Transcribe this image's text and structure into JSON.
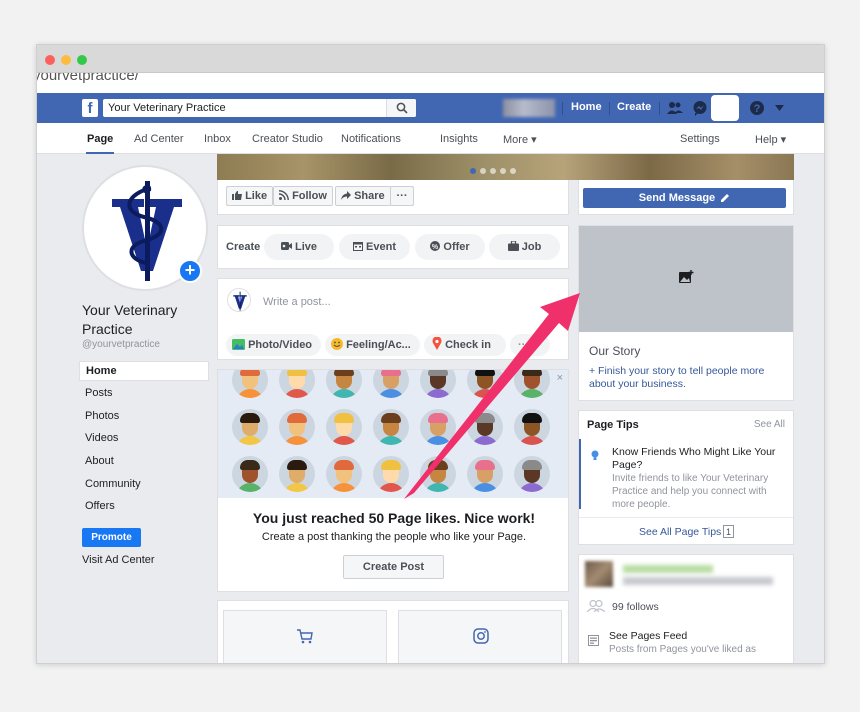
{
  "browser": {
    "url_fragment": "yourvetpractice/"
  },
  "topbar": {
    "logo": "f",
    "search_value": "Your Veterinary Practice",
    "home": "Home",
    "create": "Create"
  },
  "page_nav": {
    "items": [
      "Page",
      "Ad Center",
      "Inbox",
      "Creator Studio",
      "Notifications",
      "Insights",
      "More ▾"
    ],
    "settings": "Settings",
    "help": "Help ▾"
  },
  "profile": {
    "name": "Your Veterinary Practice",
    "handle": "@yourvetpractice",
    "add_badge": "+"
  },
  "sidebar": {
    "home": "Home",
    "items": [
      "Posts",
      "Photos",
      "Videos",
      "About",
      "Community",
      "Offers"
    ],
    "promote": "Promote",
    "visit_ad_center": "Visit Ad Center"
  },
  "actions": {
    "like": "Like",
    "follow": "Follow",
    "share": "Share",
    "more": "···",
    "send_message": "Send Message"
  },
  "create_bar": {
    "label": "Create",
    "live": "Live",
    "event": "Event",
    "offer": "Offer",
    "job": "Job"
  },
  "composer": {
    "placeholder": "Write a post...",
    "photo_video": "Photo/Video",
    "feeling": "Feeling/Ac...",
    "check_in": "Check in",
    "more": "···"
  },
  "likes_card": {
    "close": "×",
    "title": "You just reached 50 Page likes. Nice work!",
    "subtitle": "Create a post thanking the people who like your Page.",
    "button": "Create Post"
  },
  "story": {
    "title": "Our Story",
    "link": "+ Finish your story to tell people more about your business."
  },
  "tips": {
    "title": "Page Tips",
    "see_all": "See All",
    "question": "Know Friends Who Might Like Your Page?",
    "description": "Invite friends to like Your Veterinary Practice and help you connect with more people.",
    "footer_link": "See All Page Tips",
    "count": "1"
  },
  "about": {
    "follows": "99 follows",
    "feed_title": "See Pages Feed",
    "feed_desc": "Posts from Pages you've liked as"
  },
  "colors": {
    "facebook_blue": "#4267b2",
    "button_blue": "#1877f2",
    "arrow_pink": "#f0306a",
    "page_bg": "#e9ebee"
  },
  "icons": [
    "f-logo-icon",
    "search-icon",
    "friends-icon",
    "messenger-icon",
    "help-icon",
    "caret-down-icon",
    "like-icon",
    "rss-icon",
    "share-icon",
    "live-icon",
    "calendar-icon",
    "offer-icon",
    "job-icon",
    "photo-icon",
    "feeling-icon",
    "location-icon",
    "add-photo-icon",
    "lightbulb-icon",
    "people-icon",
    "feed-icon",
    "cart-icon",
    "instagram-icon"
  ]
}
